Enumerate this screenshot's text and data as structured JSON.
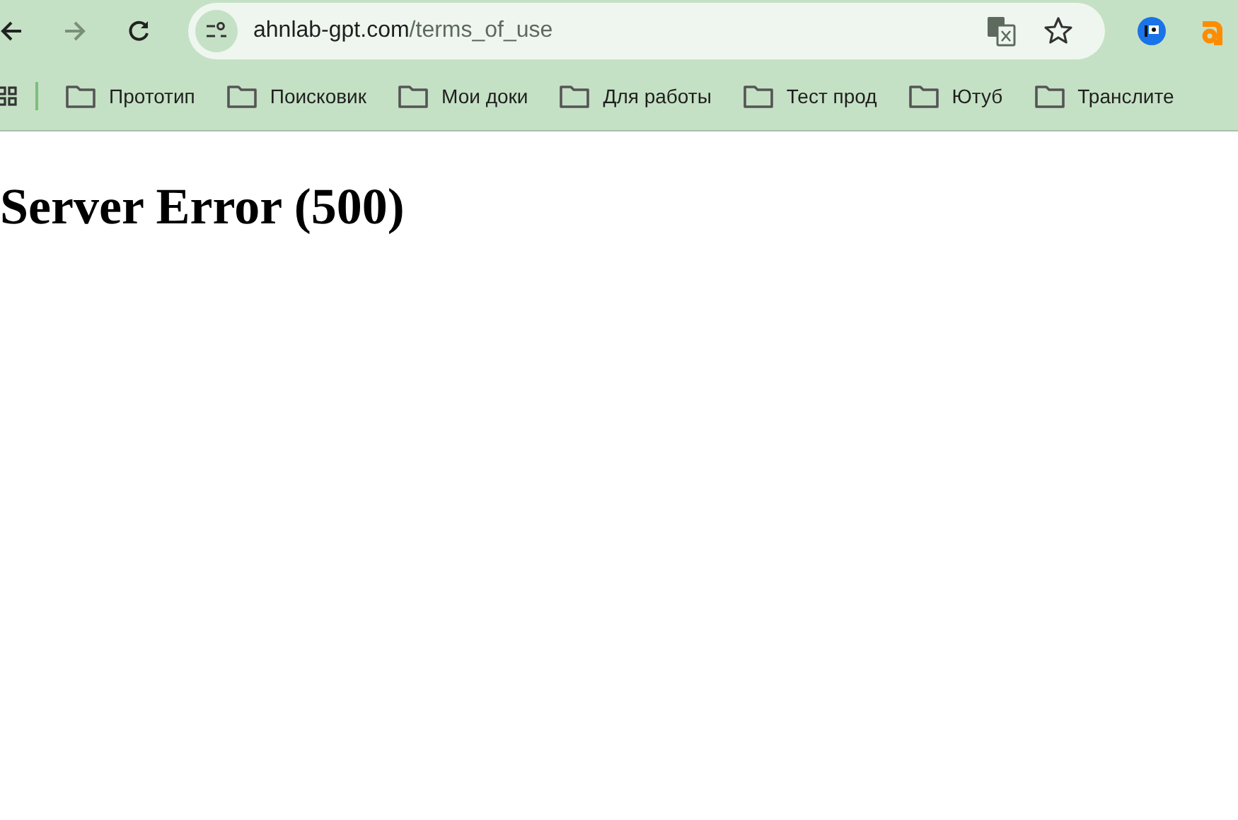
{
  "toolbar": {
    "back_enabled": true,
    "forward_enabled": false,
    "address": {
      "domain": "ahnlab-gpt.com",
      "path": "/terms_of_use"
    }
  },
  "bookmarks": [
    {
      "label": "Прототип"
    },
    {
      "label": "Поисковик"
    },
    {
      "label": "Мои доки"
    },
    {
      "label": "Для работы"
    },
    {
      "label": "Тест прод"
    },
    {
      "label": "Ютуб"
    },
    {
      "label": "Транслите"
    }
  ],
  "page": {
    "heading": "Server Error (500)"
  }
}
